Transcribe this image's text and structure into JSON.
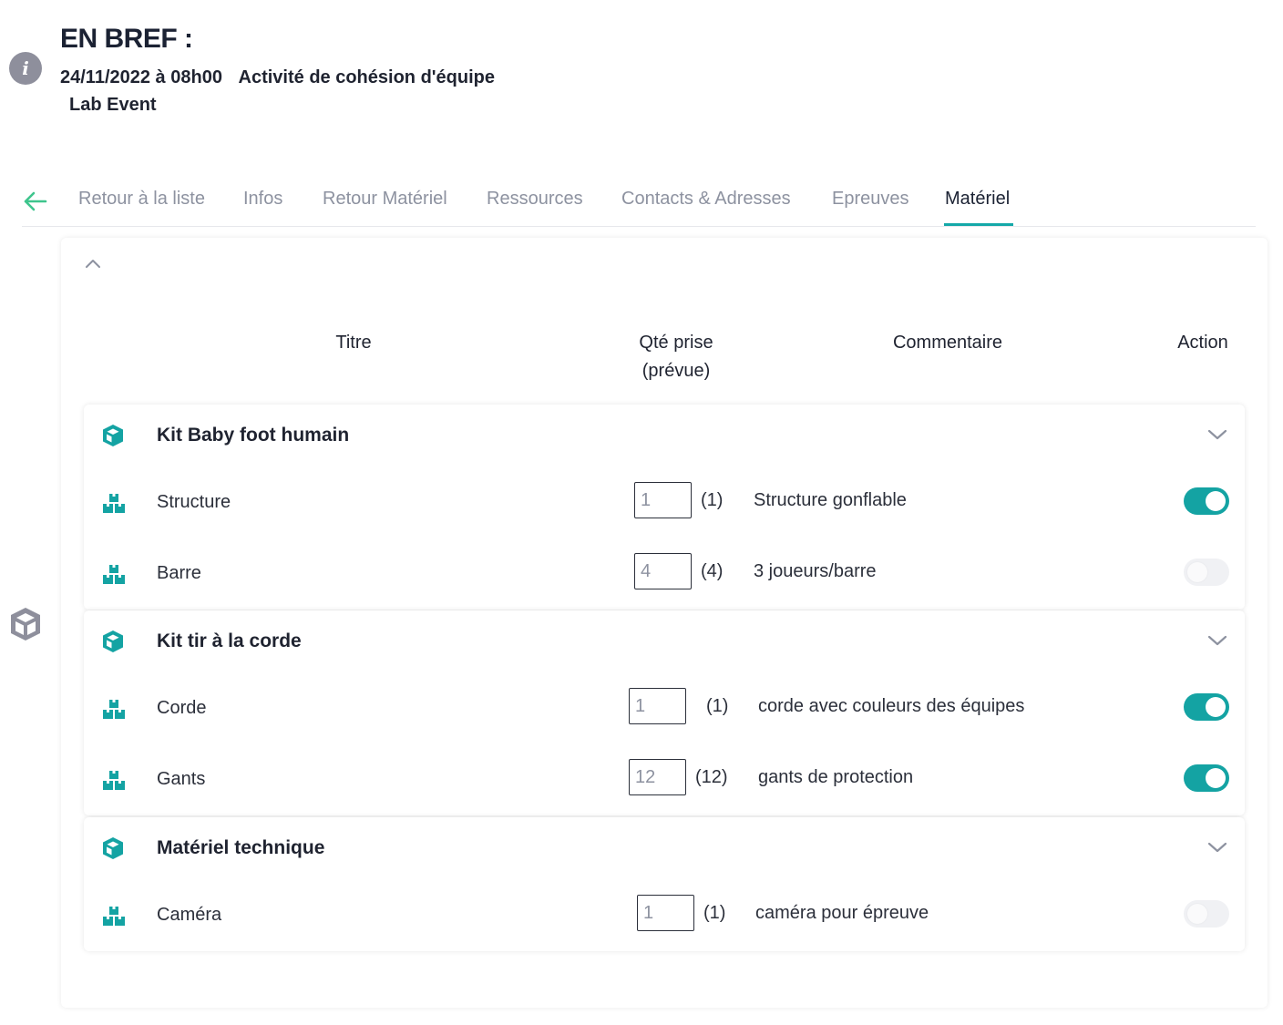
{
  "header": {
    "title": "EN BREF :",
    "datetime": "24/11/2022 à 08h00",
    "activity": "Activité de cohésion d'équipe",
    "organizer": "Lab Event"
  },
  "tabs": [
    {
      "label": "Retour à la liste",
      "active": false
    },
    {
      "label": "Infos",
      "active": false
    },
    {
      "label": "Retour Matériel",
      "active": false
    },
    {
      "label": "Ressources",
      "active": false
    },
    {
      "label": "Contacts & Adresses",
      "active": false
    },
    {
      "label": "Epreuves",
      "active": false
    },
    {
      "label": "Matériel",
      "active": true
    }
  ],
  "columns": {
    "title": "Titre",
    "qty_line1": "Qté prise",
    "qty_line2": "(prévue)",
    "comment": "Commentaire",
    "action": "Action"
  },
  "groups": [
    {
      "title": "Kit Baby foot humain",
      "items": [
        {
          "title": "Structure",
          "qty": "1",
          "planned": "(1)",
          "comment": "Structure gonflable",
          "enabled": true
        },
        {
          "title": "Barre",
          "qty": "4",
          "planned": "(4)",
          "comment": "3 joueurs/barre",
          "enabled": false
        }
      ]
    },
    {
      "title": "Kit tir à la corde",
      "items": [
        {
          "title": "Corde",
          "qty": "1",
          "planned": "(1)",
          "comment": "corde avec couleurs des équipes",
          "enabled": true
        },
        {
          "title": "Gants",
          "qty": "12",
          "planned": "(12)",
          "comment": "gants de protection",
          "enabled": true
        }
      ]
    },
    {
      "title": "Matériel technique",
      "items": [
        {
          "title": "Caméra",
          "qty": "1",
          "planned": "(1)",
          "comment": "caméra pour épreuve",
          "enabled": false
        }
      ]
    }
  ],
  "icons": {
    "info": "info-icon",
    "back": "arrow-left-icon",
    "group": "cube-icon",
    "item": "boxes-icon",
    "side": "cube-icon",
    "collapse": "chevron-up-icon",
    "expand": "chevron-down-icon"
  },
  "colors": {
    "accent": "#14a3a3",
    "back_arrow": "#3ec58d",
    "muted_tab": "#8d92a0",
    "side_icon": "#8e8f9c"
  }
}
